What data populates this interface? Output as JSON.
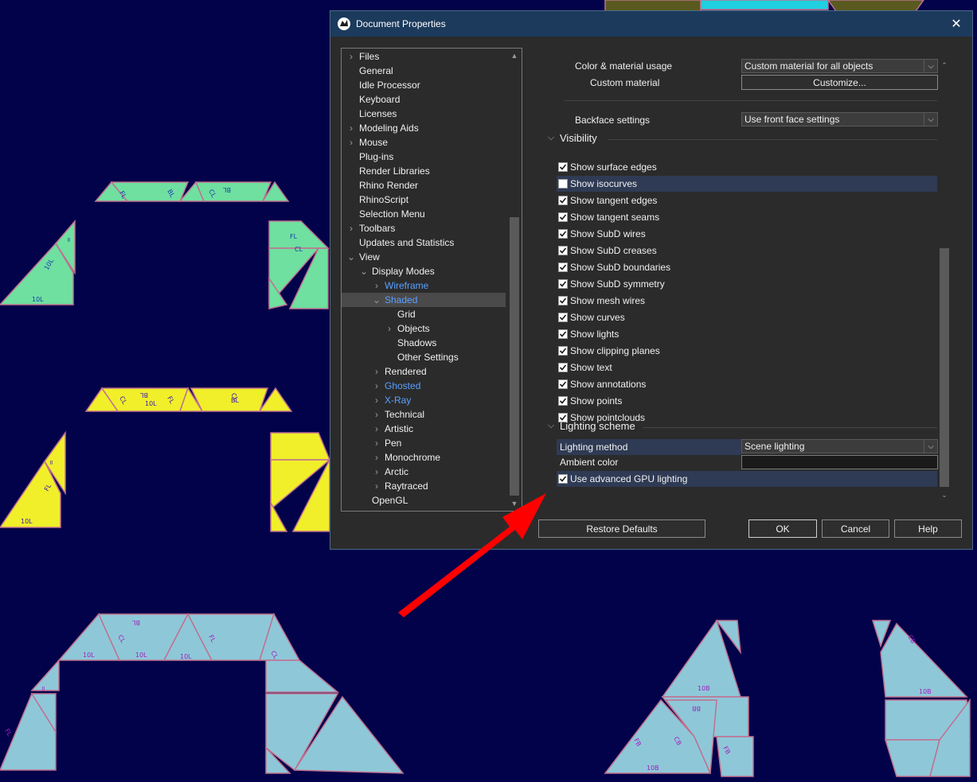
{
  "window": {
    "title": "Document Properties",
    "close_glyph": "✕"
  },
  "icons": {
    "app": "rhino-icon",
    "close": "close-icon",
    "chevron_right": "chevron-right-icon",
    "chevron_down": "chevron-down-icon"
  },
  "colors": {
    "background": "#02024a",
    "dialog_bg": "#2b2b2b",
    "titlebar": "#1c3a5c",
    "link_blue": "#5aa0ff",
    "highlight_row": "#2f3a54",
    "arrow_red": "#ff0000",
    "green_shapes": "#6fe0a0",
    "yellow_shapes": "#f0ef2a",
    "blue_shapes": "#8ec8d8"
  },
  "tree": {
    "items": [
      {
        "label": "Files",
        "level": 0,
        "expander": "right",
        "state": "normal"
      },
      {
        "label": "General",
        "level": 0,
        "expander": "none",
        "state": "normal"
      },
      {
        "label": "Idle Processor",
        "level": 0,
        "expander": "none",
        "state": "normal"
      },
      {
        "label": "Keyboard",
        "level": 0,
        "expander": "none",
        "state": "normal"
      },
      {
        "label": "Licenses",
        "level": 0,
        "expander": "none",
        "state": "normal"
      },
      {
        "label": "Modeling Aids",
        "level": 0,
        "expander": "right",
        "state": "normal"
      },
      {
        "label": "Mouse",
        "level": 0,
        "expander": "right",
        "state": "normal"
      },
      {
        "label": "Plug-ins",
        "level": 0,
        "expander": "none",
        "state": "normal"
      },
      {
        "label": "Render Libraries",
        "level": 0,
        "expander": "none",
        "state": "normal"
      },
      {
        "label": "Rhino Render",
        "level": 0,
        "expander": "none",
        "state": "normal"
      },
      {
        "label": "RhinoScript",
        "level": 0,
        "expander": "none",
        "state": "normal"
      },
      {
        "label": "Selection Menu",
        "level": 0,
        "expander": "none",
        "state": "normal"
      },
      {
        "label": "Toolbars",
        "level": 0,
        "expander": "right",
        "state": "normal"
      },
      {
        "label": "Updates and Statistics",
        "level": 0,
        "expander": "none",
        "state": "normal"
      },
      {
        "label": "View",
        "level": 0,
        "expander": "down",
        "state": "normal"
      },
      {
        "label": "Display Modes",
        "level": 1,
        "expander": "down",
        "state": "normal"
      },
      {
        "label": "Wireframe",
        "level": 2,
        "expander": "right",
        "state": "blue"
      },
      {
        "label": "Shaded",
        "level": 2,
        "expander": "down",
        "state": "selected"
      },
      {
        "label": "Grid",
        "level": 3,
        "expander": "none",
        "state": "normal"
      },
      {
        "label": "Objects",
        "level": 3,
        "expander": "right",
        "state": "normal"
      },
      {
        "label": "Shadows",
        "level": 3,
        "expander": "none",
        "state": "normal"
      },
      {
        "label": "Other Settings",
        "level": 3,
        "expander": "none",
        "state": "normal"
      },
      {
        "label": "Rendered",
        "level": 2,
        "expander": "right",
        "state": "normal"
      },
      {
        "label": "Ghosted",
        "level": 2,
        "expander": "right",
        "state": "blue"
      },
      {
        "label": "X-Ray",
        "level": 2,
        "expander": "right",
        "state": "blue"
      },
      {
        "label": "Technical",
        "level": 2,
        "expander": "right",
        "state": "normal"
      },
      {
        "label": "Artistic",
        "level": 2,
        "expander": "right",
        "state": "normal"
      },
      {
        "label": "Pen",
        "level": 2,
        "expander": "right",
        "state": "normal"
      },
      {
        "label": "Monochrome",
        "level": 2,
        "expander": "right",
        "state": "normal"
      },
      {
        "label": "Arctic",
        "level": 2,
        "expander": "right",
        "state": "normal"
      },
      {
        "label": "Raytraced",
        "level": 2,
        "expander": "right",
        "state": "normal"
      },
      {
        "label": "OpenGL",
        "level": 1,
        "expander": "none",
        "state": "normal"
      }
    ]
  },
  "settings": {
    "color_usage_label": "Color & material usage",
    "color_usage_value": "Custom material for all objects",
    "custom_material_label": "Custom material",
    "customize_button": "Customize...",
    "backface_label": "Backface settings",
    "backface_value": "Use front face settings",
    "visibility_header": "Visibility",
    "visibility_items": [
      {
        "label": "Show surface edges",
        "checked": true
      },
      {
        "label": "Show isocurves",
        "checked": false
      },
      {
        "label": "Show tangent edges",
        "checked": true
      },
      {
        "label": "Show tangent seams",
        "checked": true
      },
      {
        "label": "Show SubD wires",
        "checked": true
      },
      {
        "label": "Show SubD creases",
        "checked": true
      },
      {
        "label": "Show SubD boundaries",
        "checked": true
      },
      {
        "label": "Show SubD symmetry",
        "checked": true
      },
      {
        "label": "Show mesh wires",
        "checked": true
      },
      {
        "label": "Show curves",
        "checked": true
      },
      {
        "label": "Show lights",
        "checked": true
      },
      {
        "label": "Show clipping planes",
        "checked": true
      },
      {
        "label": "Show text",
        "checked": true
      },
      {
        "label": "Show annotations",
        "checked": true
      },
      {
        "label": "Show points",
        "checked": true
      },
      {
        "label": "Show pointclouds",
        "checked": true
      }
    ],
    "lighting_header": "Lighting scheme",
    "lighting_method_label": "Lighting method",
    "lighting_method_value": "Scene lighting",
    "ambient_color_label": "Ambient color",
    "advanced_gpu_label": "Use advanced GPU lighting",
    "advanced_gpu_checked": true
  },
  "buttons": {
    "restore_defaults": "Restore Defaults",
    "ok": "OK",
    "cancel": "Cancel",
    "help": "Help"
  },
  "shape_labels": {
    "green": [
      "10L",
      "10L",
      "FL",
      "CL",
      "FL",
      "BL",
      "CL",
      "BL",
      "="
    ],
    "yellow": [
      "10L",
      "10L",
      "FL",
      "CL",
      "FL",
      "BL",
      "CL",
      "BL",
      "="
    ],
    "blue_left": [
      "10L",
      "10L",
      "10L",
      "FL",
      "CL",
      "BL",
      "FL",
      "CL",
      "="
    ],
    "blue_right": [
      "10B",
      "10B",
      "10B",
      "FB",
      "CB",
      "BB",
      "FB",
      "CB"
    ]
  }
}
